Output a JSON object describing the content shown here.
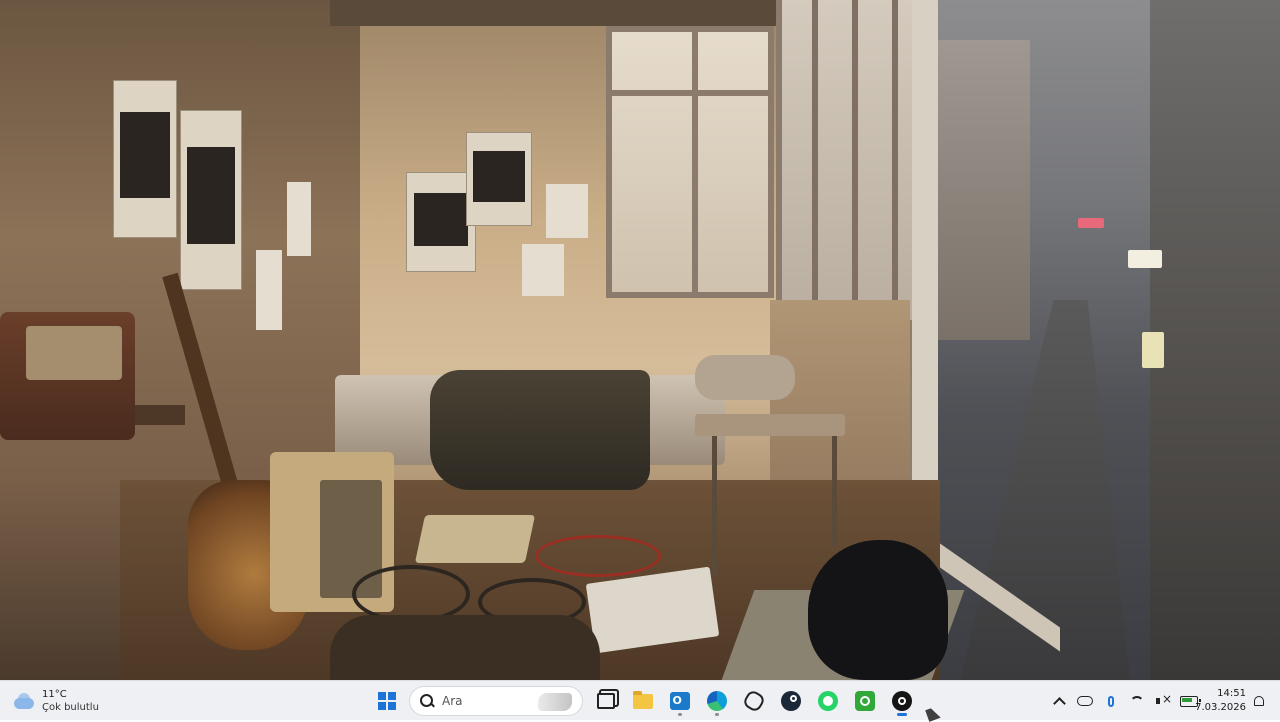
{
  "taskbar": {
    "weather": {
      "temperature": "11°C",
      "condition": "Çok bulutlu",
      "icon": "cloud-sun-icon"
    },
    "start_icon": "windows-logo-icon",
    "search": {
      "placeholder": "Ara"
    },
    "pinned_apps": [
      {
        "name": "task-view",
        "icon": "task-view-icon"
      },
      {
        "name": "file-explorer",
        "icon": "folder-icon"
      },
      {
        "name": "outlook",
        "icon": "outlook-icon"
      },
      {
        "name": "edge",
        "icon": "edge-icon"
      },
      {
        "name": "chatgpt",
        "icon": "chatgpt-icon"
      },
      {
        "name": "steam",
        "icon": "steam-icon"
      },
      {
        "name": "whatsapp",
        "icon": "whatsapp-icon"
      },
      {
        "name": "xbox",
        "icon": "xbox-icon"
      },
      {
        "name": "obs",
        "icon": "obs-icon"
      }
    ],
    "tray": {
      "icons": [
        "chevron-up-icon",
        "onedrive-icon",
        "microphone-icon",
        "wifi-icon",
        "speaker-muted-icon",
        "battery-icon"
      ]
    },
    "clock": {
      "time": "14:51",
      "date": "7.03.2026"
    },
    "notification_icon": "bell-icon",
    "accent_color": "#1e74d6"
  }
}
